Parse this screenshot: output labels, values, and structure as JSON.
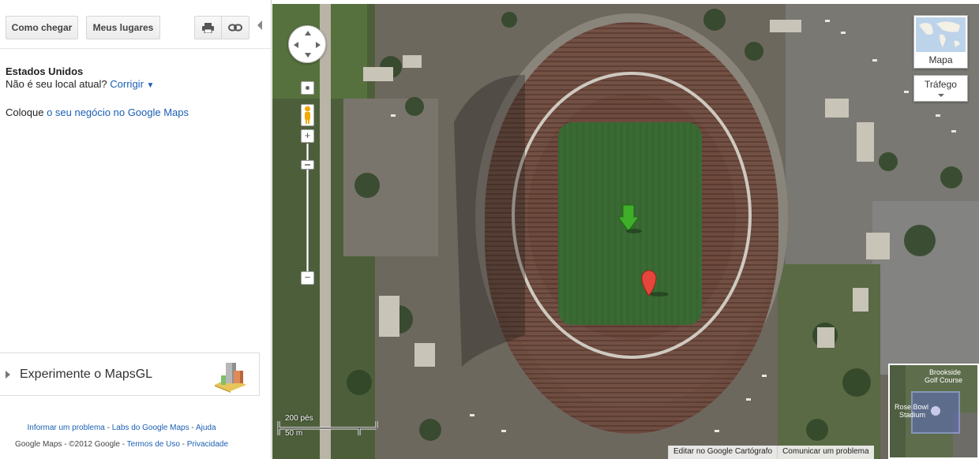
{
  "toolbar": {
    "directions_label": "Como chegar",
    "places_label": "Meus lugares",
    "print_icon": "printer-icon",
    "link_icon": "link-icon"
  },
  "location": {
    "title": "Estados Unidos",
    "question": "Não é seu local atual?",
    "fix_link": "Corrigir",
    "fix_caret": "▼"
  },
  "business": {
    "prefix": "Coloque",
    "link": "o seu negócio no Google Maps"
  },
  "mapsgl": {
    "label": "Experimente o MapsGL"
  },
  "footer": {
    "report": "Informar um problema",
    "sep1": " - ",
    "labs": "Labs do Google Maps",
    "sep2": " - ",
    "help": "Ajuda",
    "copyright": "Google Maps - ©2012 Google - ",
    "terms": "Termos de Uso",
    "sep3": " - ",
    "privacy": "Privacidade"
  },
  "map": {
    "layer_map_label": "Mapa",
    "layer_traffic_label": "Tráfego",
    "scale_top": "200 pés",
    "scale_bottom": "50 m",
    "bottom_links": [
      "Editar no Google Cartógrafo",
      "Comunicar um problema"
    ],
    "minimap_labels": [
      "Brookside",
      "Golf Course",
      "Rose Bowl",
      "Stadium"
    ]
  },
  "colors": {
    "link": "#1a5fb4",
    "field": "#3a6b34",
    "marker_red": "#e5463b",
    "marker_green": "#3fae2a"
  }
}
